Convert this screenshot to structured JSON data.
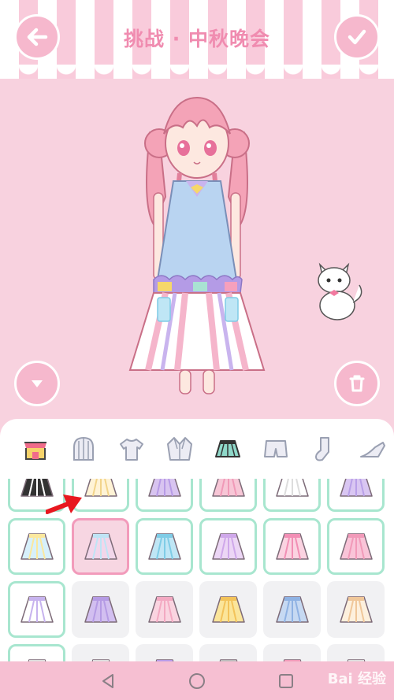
{
  "header": {
    "title": "挑战 · 中秋晚会",
    "back_icon": "arrow-left-icon",
    "confirm_icon": "checkmark-icon"
  },
  "side_controls": {
    "collapse_icon": "triangle-down-icon",
    "trash_icon": "trash-icon"
  },
  "categories": [
    {
      "id": "shop",
      "icon": "shop-icon",
      "active": false
    },
    {
      "id": "hair",
      "icon": "hair-icon",
      "active": false
    },
    {
      "id": "top",
      "icon": "tshirt-icon",
      "active": false
    },
    {
      "id": "coat",
      "icon": "jacket-icon",
      "active": false
    },
    {
      "id": "skirt",
      "icon": "skirt-icon",
      "active": true
    },
    {
      "id": "pants",
      "icon": "shorts-icon",
      "active": false
    },
    {
      "id": "socks",
      "icon": "sock-icon",
      "active": false
    },
    {
      "id": "shoes",
      "icon": "shoe-icon",
      "active": false
    }
  ],
  "items": [
    {
      "row": 0,
      "col": 0,
      "state": "owned",
      "color": "#333333",
      "accent": "#ffffff"
    },
    {
      "row": 0,
      "col": 1,
      "state": "owned",
      "color": "#fff3d6",
      "accent": "#f2d48a"
    },
    {
      "row": 0,
      "col": 2,
      "state": "owned",
      "color": "#d8c4f0",
      "accent": "#b79be6"
    },
    {
      "row": 0,
      "col": 3,
      "state": "owned",
      "color": "#f7c6d6",
      "accent": "#f09ab8"
    },
    {
      "row": 0,
      "col": 4,
      "state": "owned",
      "color": "#ffffff",
      "accent": "#dddddd"
    },
    {
      "row": 0,
      "col": 5,
      "state": "owned",
      "color": "#d9c6f2",
      "accent": "#b9a0e8"
    },
    {
      "row": 1,
      "col": 0,
      "state": "owned",
      "color": "#d7f0fb",
      "accent": "#fbe89e"
    },
    {
      "row": 1,
      "col": 1,
      "state": "selected",
      "color": "#f2d6ea",
      "accent": "#bfe4f5"
    },
    {
      "row": 1,
      "col": 2,
      "state": "owned",
      "color": "#bfe6f5",
      "accent": "#7fcce6"
    },
    {
      "row": 1,
      "col": 3,
      "state": "owned",
      "color": "#ecd6f5",
      "accent": "#cfa8ea"
    },
    {
      "row": 1,
      "col": 4,
      "state": "owned",
      "color": "#fbd3e1",
      "accent": "#f28fb5"
    },
    {
      "row": 1,
      "col": 5,
      "state": "owned",
      "color": "#f9c4d8",
      "accent": "#f19ab9"
    },
    {
      "row": 2,
      "col": 0,
      "state": "owned",
      "color": "#ffffff",
      "accent": "#c7b3ee"
    },
    {
      "row": 2,
      "col": 1,
      "state": "locked",
      "color": "#d2bff0",
      "accent": "#b59be4"
    },
    {
      "row": 2,
      "col": 2,
      "state": "locked",
      "color": "#fad4e0",
      "accent": "#f3a9c2"
    },
    {
      "row": 2,
      "col": 3,
      "state": "locked",
      "color": "#fbe59a",
      "accent": "#f3c35a"
    },
    {
      "row": 2,
      "col": 4,
      "state": "locked",
      "color": "#c6d9f2",
      "accent": "#8fb2e3"
    },
    {
      "row": 2,
      "col": 5,
      "state": "locked",
      "color": "#fdf0dd",
      "accent": "#f0c79a"
    },
    {
      "row": 3,
      "col": 0,
      "state": "owned",
      "color": "#ffffff",
      "accent": "#dddddd"
    },
    {
      "row": 3,
      "col": 1,
      "state": "locked",
      "color": "#ffffff",
      "accent": "#dddddd"
    },
    {
      "row": 3,
      "col": 2,
      "state": "locked",
      "color": "#d8c4f0",
      "accent": "#b79be6"
    },
    {
      "row": 3,
      "col": 3,
      "state": "locked",
      "color": "#e6e6e6",
      "accent": "#bbbbbb"
    },
    {
      "row": 3,
      "col": 4,
      "state": "locked",
      "color": "#f7c6d6",
      "accent": "#f09ab8"
    },
    {
      "row": 3,
      "col": 5,
      "state": "locked",
      "color": "#ffffff",
      "accent": "#dddddd"
    }
  ],
  "navbar": {
    "back_icon": "nav-back-icon",
    "home_icon": "nav-home-icon",
    "recents_icon": "nav-recents-icon"
  },
  "watermark": "Bai 经验",
  "colors": {
    "accent_pink": "#f6b8cd",
    "title_pink": "#f08cb0",
    "owned_border": "#a8e6cf",
    "selected_border": "#f29bbb",
    "pointer_red": "#e8171f"
  }
}
